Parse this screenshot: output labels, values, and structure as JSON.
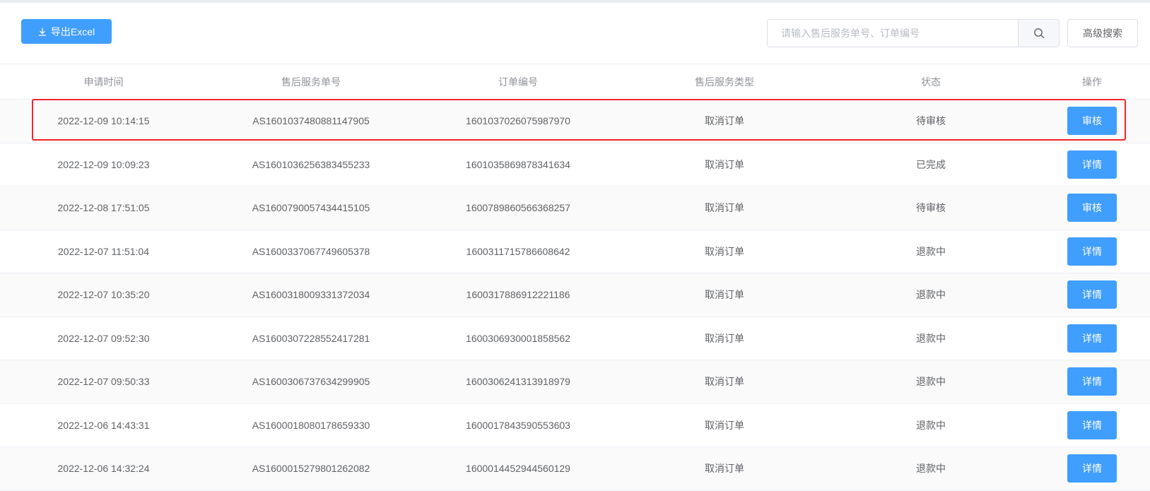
{
  "toolbar": {
    "export_label": "导出Excel",
    "search_placeholder": "请输入售后服务单号、订单编号",
    "search_value": "",
    "advanced_label": "高级搜索"
  },
  "table": {
    "columns": [
      "申请时间",
      "售后服务单号",
      "订单编号",
      "售后服务类型",
      "状态",
      "操作"
    ],
    "rows": [
      {
        "time": "2022-12-09 10:14:15",
        "service_no": "AS1601037480881147905",
        "order_no": "1601037026075987970",
        "type": "取消订单",
        "status": "待审核",
        "action": "审核"
      },
      {
        "time": "2022-12-09 10:09:23",
        "service_no": "AS1601036256383455233",
        "order_no": "1601035869878341634",
        "type": "取消订单",
        "status": "已完成",
        "action": "详情"
      },
      {
        "time": "2022-12-08 17:51:05",
        "service_no": "AS1600790057434415105",
        "order_no": "1600789860566368257",
        "type": "取消订单",
        "status": "待审核",
        "action": "审核"
      },
      {
        "time": "2022-12-07 11:51:04",
        "service_no": "AS1600337067749605378",
        "order_no": "1600311715786608642",
        "type": "取消订单",
        "status": "退款中",
        "action": "详情"
      },
      {
        "time": "2022-12-07 10:35:20",
        "service_no": "AS1600318009331372034",
        "order_no": "1600317886912221186",
        "type": "取消订单",
        "status": "退款中",
        "action": "详情"
      },
      {
        "time": "2022-12-07 09:52:30",
        "service_no": "AS1600307228552417281",
        "order_no": "1600306930001858562",
        "type": "取消订单",
        "status": "退款中",
        "action": "详情"
      },
      {
        "time": "2022-12-07 09:50:33",
        "service_no": "AS1600306737634299905",
        "order_no": "1600306241313918979",
        "type": "取消订单",
        "status": "退款中",
        "action": "详情"
      },
      {
        "time": "2022-12-06 14:43:31",
        "service_no": "AS1600018080178659330",
        "order_no": "1600017843590553603",
        "type": "取消订单",
        "status": "退款中",
        "action": "详情"
      },
      {
        "time": "2022-12-06 14:32:24",
        "service_no": "AS1600015279801262082",
        "order_no": "1600014452944560129",
        "type": "取消订单",
        "status": "退款中",
        "action": "详情"
      }
    ]
  },
  "colors": {
    "primary": "#409eff",
    "highlight_border": "#f2232c",
    "stripe": "#fafafa"
  },
  "icons": {
    "export": "download-icon",
    "search": "search-icon"
  }
}
